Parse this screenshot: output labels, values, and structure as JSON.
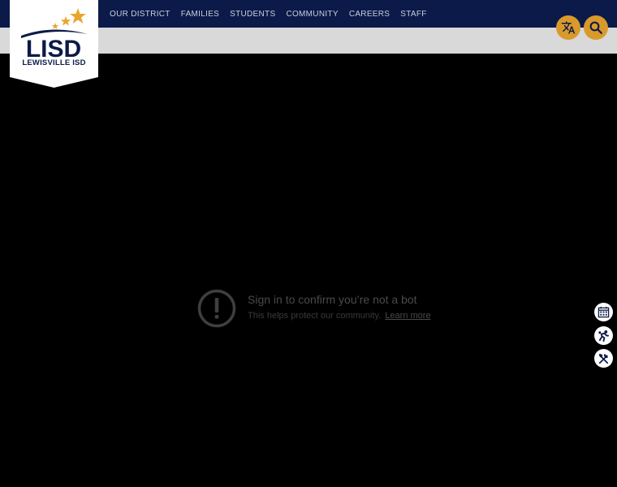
{
  "logo": {
    "text": "LEWISVILLE ISD",
    "mark_text": "LISD"
  },
  "nav": {
    "items": [
      {
        "label": "OUR DISTRICT"
      },
      {
        "label": "FAMILIES"
      },
      {
        "label": "STUDENTS"
      },
      {
        "label": "COMMUNITY"
      },
      {
        "label": "CAREERS"
      },
      {
        "label": "STAFF"
      }
    ]
  },
  "header_buttons": {
    "translate_icon": "translate-icon",
    "search_icon": "search-icon"
  },
  "video_notice": {
    "title": "Sign in to confirm you’re not a bot",
    "subtitle": "This helps protect our community.",
    "link": "Learn more"
  },
  "side_buttons": {
    "icons": [
      "calendar-icon",
      "sports-icon",
      "dining-icon"
    ]
  },
  "colors": {
    "navy": "#0b1a48",
    "gold": "#d99a2b",
    "light_gray": "#d9d9d9"
  }
}
